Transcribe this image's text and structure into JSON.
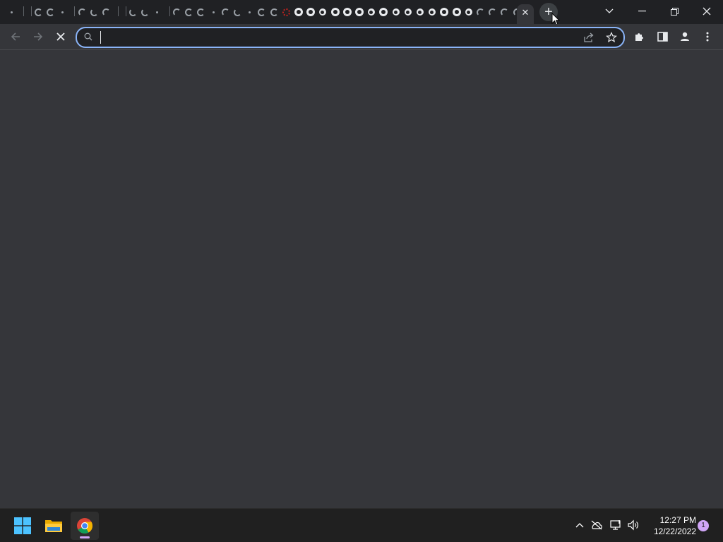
{
  "browser": {
    "tabs": {
      "spinner_tab_count": 40,
      "active_tab_close": "✕",
      "new_tab_label": "+"
    },
    "omnibox": {
      "value": "",
      "placeholder": ""
    },
    "colors": {
      "omnibox_focus": "#8ab4f8",
      "content_bg": "#35363a",
      "frame_bg": "#202124"
    },
    "toolbar_icons": [
      "back-arrow-icon",
      "forward-arrow-icon",
      "stop-icon",
      "share-icon",
      "star-icon",
      "extensions-icon",
      "side-panel-icon",
      "profile-icon",
      "more-menu-icon"
    ]
  },
  "taskbar": {
    "apps": [
      "windows-start-icon",
      "file-explorer-icon",
      "chrome-icon"
    ],
    "tray_icons": [
      "chevron-up-icon",
      "onedrive-offline-icon",
      "network-icon",
      "volume-icon"
    ],
    "time": "12:27 PM",
    "date": "12/22/2022",
    "notification_count": "1"
  }
}
